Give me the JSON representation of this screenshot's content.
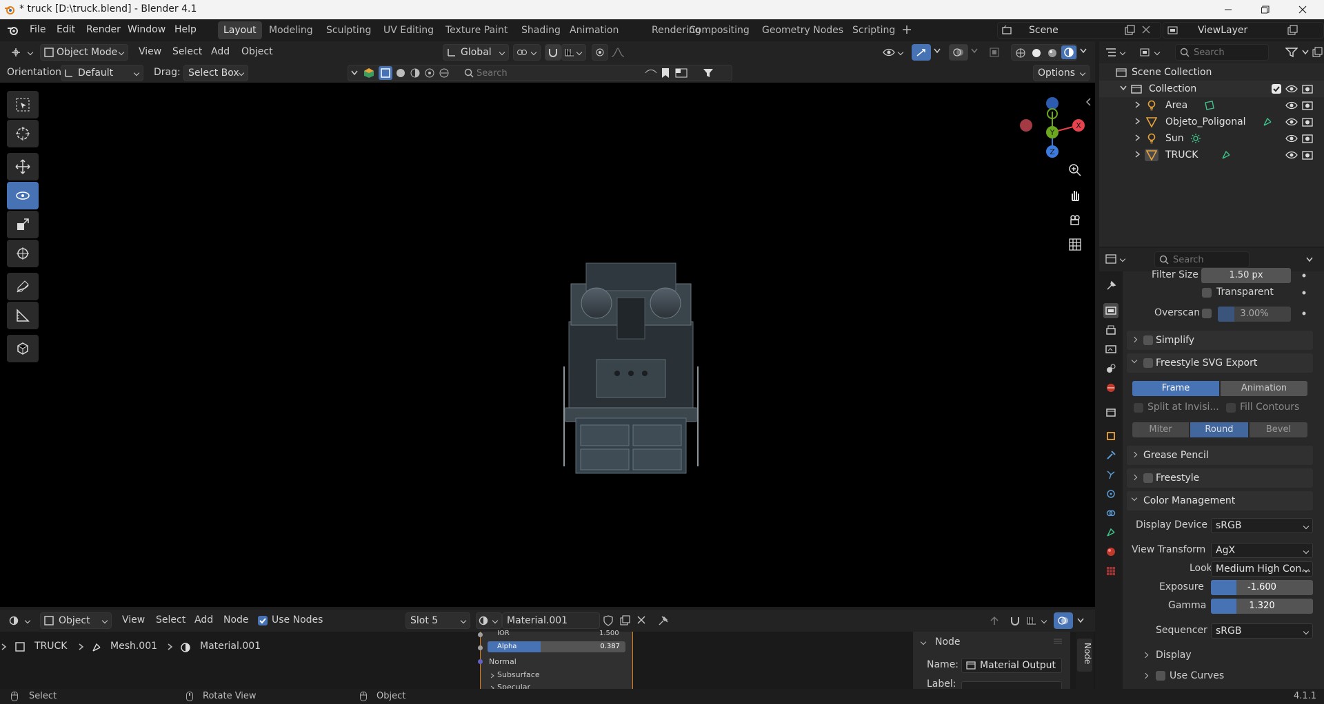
{
  "titlebar": {
    "title": "* truck [D:\\truck.blend] - Blender 4.1"
  },
  "menu": [
    "File",
    "Edit",
    "Render",
    "Window",
    "Help"
  ],
  "workspaces": [
    {
      "label": "Layout",
      "active": true
    },
    {
      "label": "Modeling"
    },
    {
      "label": "Sculpting"
    },
    {
      "label": "UV Editing"
    },
    {
      "label": "Texture Paint"
    },
    {
      "label": "Shading"
    },
    {
      "label": "Animation"
    },
    {
      "label": "Rendering"
    },
    {
      "label": "Compositing"
    },
    {
      "label": "Geometry Nodes"
    },
    {
      "label": "Scripting"
    }
  ],
  "scene": {
    "name": "Scene",
    "view_layer": "ViewLayer"
  },
  "viewport": {
    "mode": "Object Mode",
    "menus": [
      "View",
      "Select",
      "Add",
      "Object"
    ],
    "transform_orientation": "Global",
    "orientation_label": "Orientation:",
    "orientation_value": "Default",
    "drag_label": "Drag:",
    "drag_value": "Select Box",
    "search_placeholder": "Search",
    "options_label": "Options",
    "gizmo": {
      "x": "X",
      "y": "Y",
      "z": "Z"
    }
  },
  "outliner": {
    "search_placeholder": "Search",
    "root": "Scene Collection",
    "collection": "Collection",
    "items": [
      {
        "name": "Area",
        "type_icon": "light-icon",
        "data_icon": "area-light-data-icon"
      },
      {
        "name": "Objeto_Poligonal",
        "type_icon": "mesh-object-icon",
        "data_icon": "mesh-data-icon"
      },
      {
        "name": "Sun",
        "type_icon": "light-icon",
        "data_icon": "sun-light-data-icon"
      },
      {
        "name": "TRUCK",
        "type_icon": "mesh-object-icon",
        "data_icon": "mesh-data-icon"
      }
    ]
  },
  "properties": {
    "search_placeholder": "Search",
    "filter_size_label": "Filter Size",
    "filter_size_value": "1.50 px",
    "transparent_label": "Transparent",
    "overscan_label": "Overscan",
    "overscan_value": "3.00%",
    "simplify": "Simplify",
    "freestyle_svg": "Freestyle SVG Export",
    "frame": "Frame",
    "animation": "Animation",
    "split": "Split at Invisi...",
    "fill_contours": "Fill Contours",
    "miter": "Miter",
    "round": "Round",
    "bevel": "Bevel",
    "grease_pencil": "Grease Pencil",
    "freestyle": "Freestyle",
    "color_management": "Color Management",
    "display_device_label": "Display Device",
    "display_device_value": "sRGB",
    "view_transform_label": "View Transform",
    "view_transform_value": "AgX",
    "look_label": "Look",
    "look_value": "Medium High Con...",
    "exposure_label": "Exposure",
    "exposure_value": "-1.600",
    "exposure_fraction": 0.25,
    "gamma_label": "Gamma",
    "gamma_value": "1.320",
    "gamma_fraction": 0.25,
    "sequencer_label": "Sequencer",
    "sequencer_value": "sRGB",
    "display_sub": "Display",
    "use_curves": "Use Curves"
  },
  "node_editor": {
    "type": "Object",
    "menus": [
      "View",
      "Select",
      "Add",
      "Node"
    ],
    "use_nodes_label": "Use Nodes",
    "slot": "Slot 5",
    "material": "Material.001",
    "breadcrumb": [
      "TRUCK",
      "Mesh.001",
      "Material.001"
    ],
    "node_rows": {
      "ior_label": "IOR",
      "ior_value": "1.500",
      "alpha_label": "Alpha",
      "alpha_value": "0.387",
      "alpha_fraction": 0.387,
      "normal": "Normal",
      "subsurface": "Subsurface",
      "specular": "Specular"
    },
    "sidebar": {
      "panel": "Node",
      "name_label": "Name:",
      "name_value": "Material Output",
      "label_label": "Label:",
      "tab_node": "Node"
    }
  },
  "statusbar": {
    "select": "Select",
    "rotate": "Rotate View",
    "object": "Object",
    "version": "4.1.1"
  },
  "colors": {
    "accent": "#4772b3",
    "x_axis": "#e8424e",
    "y_axis": "#6ba81e",
    "z_axis": "#3b7be0"
  }
}
